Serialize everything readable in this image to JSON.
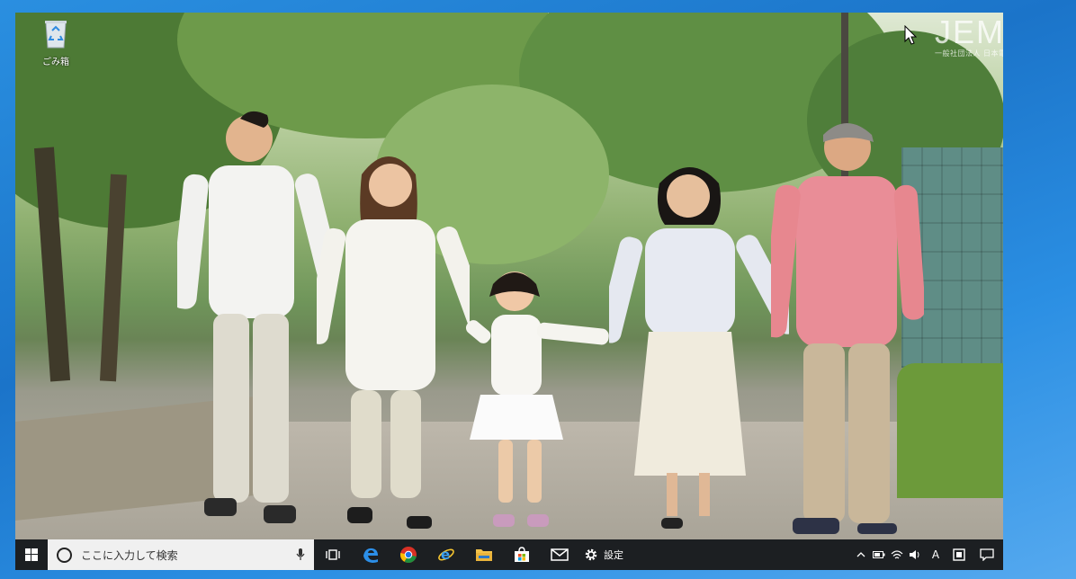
{
  "desktop": {
    "recycle_bin_label": "ごみ箱"
  },
  "watermark": {
    "title": "JEMTC",
    "subtitle": "一般社団法人 日本電子機器補修協会"
  },
  "taskbar": {
    "search_placeholder": "ここに入力して検索",
    "settings_label": "設定",
    "ime_label": "A"
  },
  "icons": {
    "start": "windows-logo-icon",
    "search": "search-circle-icon",
    "mic": "microphone-icon",
    "task_view": "task-view-icon",
    "edge": "edge-browser-icon",
    "chrome": "chrome-icon",
    "ie": "internet-explorer-icon",
    "explorer": "file-explorer-icon",
    "store": "store-icon",
    "mail": "mail-icon",
    "settings": "gear-icon"
  },
  "colors": {
    "taskbar": "#1c1f22",
    "search_box": "#f0f0f0",
    "desktop_border": "#1b74c9"
  }
}
